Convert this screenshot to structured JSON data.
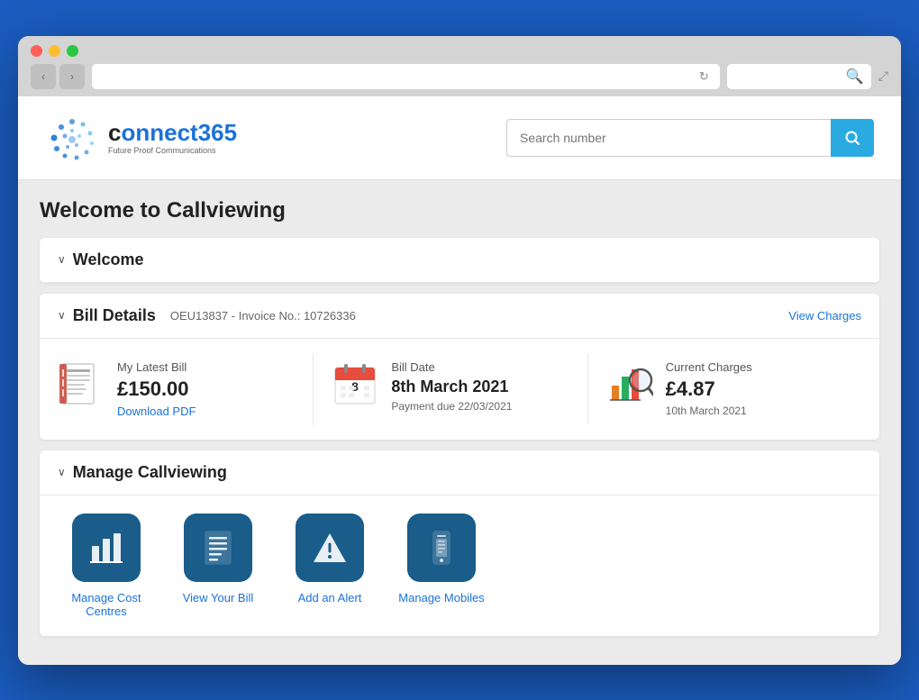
{
  "browser": {
    "back_label": "‹",
    "forward_label": "›",
    "reload_label": "↻",
    "search_placeholder": "",
    "expand_label": "⤢"
  },
  "header": {
    "logo_brand_prefix": "c",
    "logo_brand_main": "nnect365",
    "logo_tagline": "Future Proof Communications",
    "search_placeholder": "Search number",
    "search_button_label": "🔍"
  },
  "page": {
    "title": "Welcome to Callviewing"
  },
  "welcome_section": {
    "chevron": "∨",
    "title": "Welcome"
  },
  "bill_section": {
    "chevron": "∨",
    "title": "Bill Details",
    "subtitle": "OEU13837 - Invoice No.: 10726336",
    "view_charges_label": "View Charges",
    "cards": [
      {
        "id": "latest-bill",
        "label": "My Latest Bill",
        "value": "£150.00",
        "link": "Download PDF"
      },
      {
        "id": "bill-date",
        "label": "Bill Date",
        "value": "8th March 2021",
        "sub": "Payment due 22/03/2021"
      },
      {
        "id": "current-charges",
        "label": "Current Charges",
        "value": "£4.87",
        "sub": "10th March 2021"
      }
    ]
  },
  "manage_section": {
    "chevron": "∨",
    "title": "Manage Callviewing",
    "items": [
      {
        "id": "cost-centres",
        "icon": "📊",
        "label": "Manage Cost Centres"
      },
      {
        "id": "view-bill",
        "icon": "📋",
        "label": "View Your Bill"
      },
      {
        "id": "add-alert",
        "icon": "⚠",
        "label": "Add an Alert"
      },
      {
        "id": "manage-mobiles",
        "icon": "📱",
        "label": "Manage Mobiles"
      }
    ]
  },
  "colors": {
    "accent_blue": "#1a72d9",
    "button_blue": "#29abe2",
    "icon_dark_blue": "#1a5c8a",
    "logo_blue": "#1a72d9"
  }
}
